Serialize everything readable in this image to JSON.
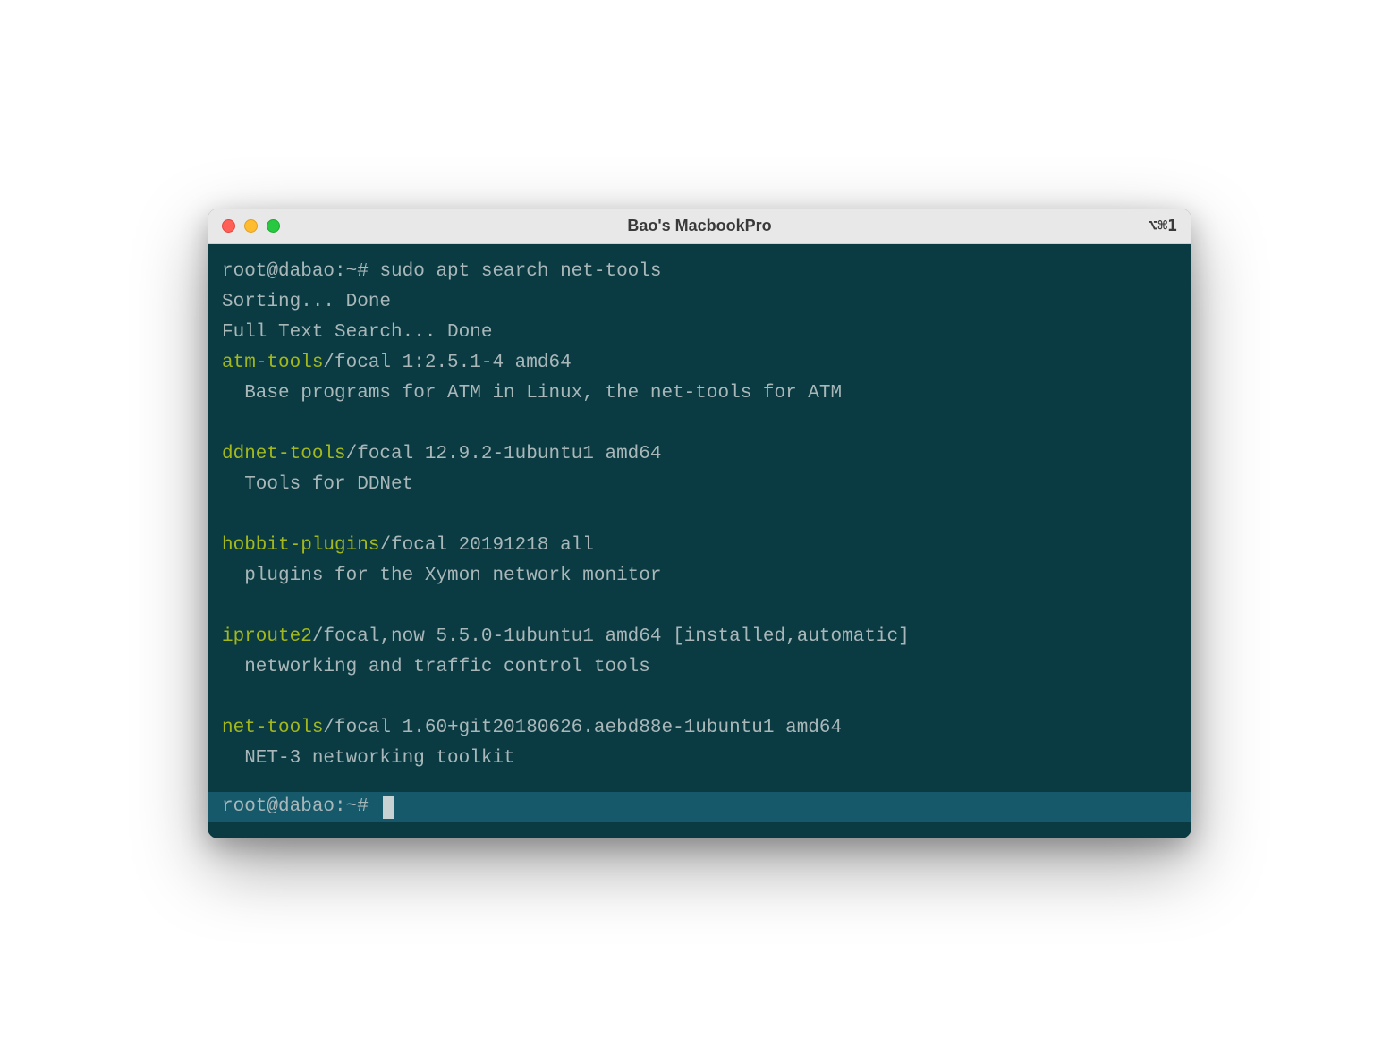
{
  "titlebar": {
    "title": "Bao's MacbookPro",
    "shortcut": "⌥⌘1"
  },
  "colors": {
    "terminal_bg": "#0a3a42",
    "text": "#a9b7b9",
    "pkg_name": "#a3b81b",
    "active_line_bg": "#15596b"
  },
  "prompt_line": {
    "prompt": "root@dabao:~# ",
    "command": "sudo apt search net-tools"
  },
  "status_lines": [
    "Sorting... Done",
    "Full Text Search... Done"
  ],
  "packages": [
    {
      "name": "atm-tools",
      "meta": "/focal 1:2.5.1-4 amd64",
      "desc": "  Base programs for ATM in Linux, the net-tools for ATM"
    },
    {
      "name": "ddnet-tools",
      "meta": "/focal 12.9.2-1ubuntu1 amd64",
      "desc": "  Tools for DDNet"
    },
    {
      "name": "hobbit-plugins",
      "meta": "/focal 20191218 all",
      "desc": "  plugins for the Xymon network monitor"
    },
    {
      "name": "iproute2",
      "meta": "/focal,now 5.5.0-1ubuntu1 amd64 [installed,automatic]",
      "desc": "  networking and traffic control tools"
    },
    {
      "name": "net-tools",
      "meta": "/focal 1.60+git20180626.aebd88e-1ubuntu1 amd64",
      "desc": "  NET-3 networking toolkit"
    }
  ],
  "active_prompt": "root@dabao:~# "
}
